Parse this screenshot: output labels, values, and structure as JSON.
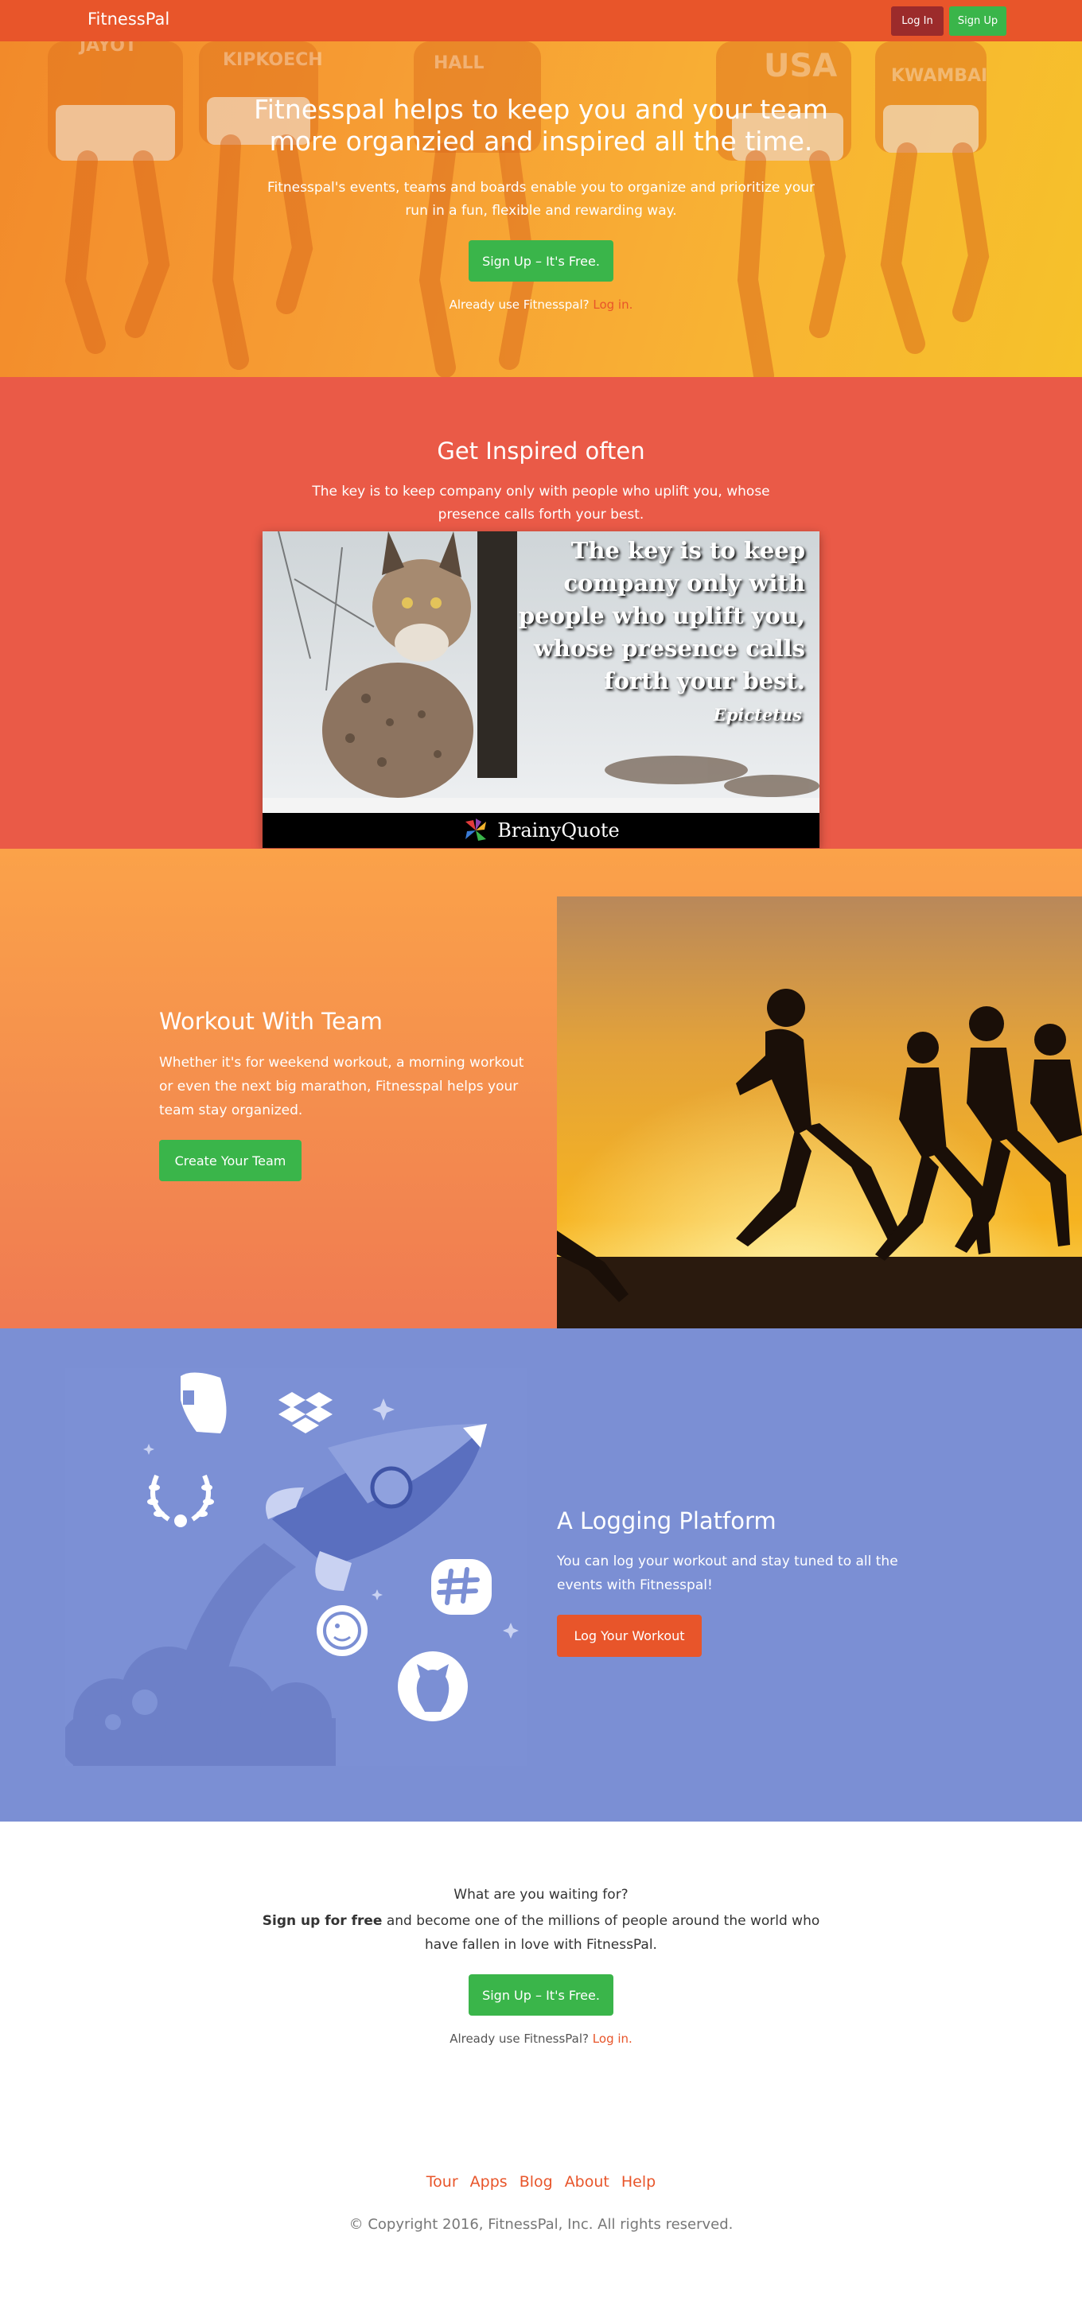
{
  "navbar": {
    "brand": "FitnessPal",
    "login_label": "Log In",
    "signup_label": "Sign Up"
  },
  "hero": {
    "title": "Fitnesspal helps to keep you and your team more organzied and inspired all the time.",
    "subtitle": "Fitnesspal's events, teams and boards enable you to organize and prioritize your run in a fun, flexible and rewarding way.",
    "cta_label": "Sign Up – It's Free.",
    "already_text": "Already use Fitnesspal?",
    "already_link": "Log in.",
    "bib_names": [
      "JAYOT",
      "KIPKOECH",
      "HALL",
      "USA",
      "KWAMBAI"
    ]
  },
  "inspired": {
    "title": "Get Inspired often",
    "subtitle": "The key is to keep company only with people who uplift you, whose presence calls forth your best.",
    "quote_lines": [
      "The key is to keep",
      "company only with",
      "people who uplift you,",
      "whose presence calls",
      "forth your best."
    ],
    "quote_author": "Epictetus",
    "quote_brand": "BrainyQuote"
  },
  "workout": {
    "title": "Workout With Team",
    "text": "Whether it's for weekend workout, a morning workout or even the next big marathon, Fitnesspal helps your team stay organized.",
    "button_label": "Create Your Team"
  },
  "logging": {
    "title": "A Logging Platform",
    "text": "You can log your workout and stay tuned to all the events with Fitnesspal!",
    "button_label": "Log Your Workout",
    "icons": [
      "evernote-icon",
      "dropbox-icon",
      "laurel-icon",
      "slack-icon",
      "mailchimp-icon",
      "github-icon",
      "rocket-icon"
    ]
  },
  "final_cta": {
    "question": "What are you waiting for?",
    "bold": "Sign up for free",
    "text_rest": " and become one of the millions of people around the world who have fallen in love with FitnessPal.",
    "button_label": "Sign Up – It's Free.",
    "already_text": "Already use FitnessPal?",
    "already_link": "Log in."
  },
  "footer": {
    "links": [
      "Tour",
      "Apps",
      "Blog",
      "About",
      "Help"
    ],
    "copyright": "© Copyright 2016, FitnessPal, Inc. All rights reserved."
  },
  "colors": {
    "nav": "#e8552a",
    "green": "#3ab54a",
    "inspired_bg": "#ea5a47",
    "logging_bg": "#7b8fd4",
    "link_orange": "#e8552a"
  }
}
